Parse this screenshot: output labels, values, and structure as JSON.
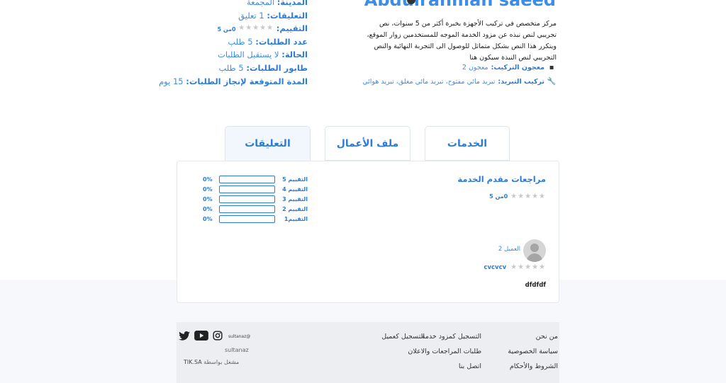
{
  "profile": {
    "name": "Abdulrahman saeed",
    "description": "مركز متخصص في تركيب الأجهزة بخبرة أكثر من 5 سنوات، نص تجريبي لنص نبذه عن مزود الخدمة الموجه للمستخدمين زوار الموقع، ويتكرر هذا النص بشكل متماثل للوصول الى التجربة النهائية والنص التجريبي لنص النبذة سيكون هنا",
    "specs": [
      {
        "label": "معجون التركيب:",
        "value": "معجون 2",
        "icon": "paste-icon"
      },
      {
        "label": "تركيب التبريد:",
        "value": "تبريد مائي مفتوح، تبريد مائي مغلق، تبريد هوائي",
        "icon": "wrench-icon"
      }
    ]
  },
  "info": {
    "city_label": "المدينة:",
    "city_value": "المجمعة",
    "comments_label": "التعليقات:",
    "comments_value": "1 تعليق",
    "rating_label": "التقييم:",
    "rating_value": "0من 5",
    "orders_label": "عدد الطلبات:",
    "orders_value": "5 طلب",
    "status_label": "الحالة:",
    "status_value": "لا يستقبل الطلبات",
    "queue_label": "طابور الطلبات:",
    "queue_value": "5 طلب",
    "eta_label": "المدة المتوقعة لإنجاز الطلبات:",
    "eta_value": "15 يوم"
  },
  "tabs": [
    {
      "label": "الخدمات",
      "active": false
    },
    {
      "label": "ملف الأعمال",
      "active": false
    },
    {
      "label": "التعليقات",
      "active": true
    }
  ],
  "reviews": {
    "title": "مراجعات مقدم الخدمة",
    "score_text": "0من 5",
    "breakdown": [
      {
        "label": "التقييم 5",
        "percent": "0%",
        "fill": 0
      },
      {
        "label": "التقييم 4",
        "percent": "0%",
        "fill": 0
      },
      {
        "label": "التقييم 3",
        "percent": "0%",
        "fill": 0
      },
      {
        "label": "التقييم 2",
        "percent": "0%",
        "fill": 0
      },
      {
        "label": "التقييم1",
        "percent": "0%",
        "fill": 0
      }
    ],
    "items": [
      {
        "name": "العميل 2",
        "title": "cvcvcv",
        "comment": "dfdfdf",
        "stars": 0
      }
    ]
  },
  "footer": {
    "col1": [
      "من نحن",
      "سياسة الخصوصية",
      "الشروط والأحكام"
    ],
    "col2": [
      "التسجيل كمزود خدمة",
      "طلبات المراجعات والاعلان",
      "اتصل بنا"
    ],
    "col3": [
      "التسجيل كعميل"
    ],
    "social_handle": "sultanaz@",
    "user": "sultanaz",
    "powered_label": "مشغل بواسطة",
    "powered_brand": "TIK.SA"
  },
  "colors": {
    "accent": "#2b7cd9",
    "star_empty": "#c8c8c8"
  }
}
